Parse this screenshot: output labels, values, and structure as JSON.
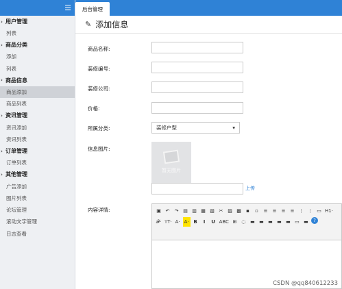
{
  "sidebar": {
    "menu_icon": "menu-icon",
    "groups": [
      {
        "label": "用户管理",
        "items": [
          "列表"
        ]
      },
      {
        "label": "商品分类",
        "items": [
          "添加",
          "列表"
        ]
      },
      {
        "label": "商品信息",
        "items": [
          "商品添加",
          "商品列表"
        ]
      },
      {
        "label": "资讯管理",
        "items": [
          "资讯添加",
          "资讯列表"
        ]
      },
      {
        "label": "订单管理",
        "items": [
          "订单列表"
        ]
      },
      {
        "label": "其他管理",
        "items": [
          "广告添加",
          "图片列表",
          "论坛管理",
          "滚动文字管理",
          "日志查看"
        ]
      }
    ],
    "active_item": "商品添加"
  },
  "topbar": {
    "tab_label": "后台管理"
  },
  "page": {
    "title": "添加信息",
    "title_icon": "edit-icon"
  },
  "form": {
    "name_label": "商品名称:",
    "code_label": "装修编号:",
    "company_label": "装修公司:",
    "price_label": "价格:",
    "category_label": "所属分类:",
    "category_value": "装修户型",
    "image_label": "信息图片:",
    "image_placeholder": "暂无图片",
    "upload_link": "上传",
    "content_label": "内容详情:"
  },
  "editor": {
    "toolbar": [
      "▣",
      "↶",
      "↷",
      "▤",
      "▥",
      "▦",
      "▧",
      "✂",
      "▨",
      "▩",
      "▪",
      "▫",
      "≡",
      "≡",
      "≡",
      "≡",
      "⋮",
      "⋮",
      "▭",
      "H1·",
      "𝓕·",
      "тT·",
      "A·",
      "A·",
      "B",
      "I",
      "U",
      "ABC",
      "⊞",
      "◌",
      "▬",
      "▬",
      "▬",
      "▬",
      "▬",
      "▭",
      "▬",
      "?"
    ]
  },
  "watermark": "CSDN @qq840612233",
  "colors": {
    "accent": "#2f82d6",
    "sidebar_bg": "#eef0f3",
    "active_bg": "#cfd2d7"
  }
}
